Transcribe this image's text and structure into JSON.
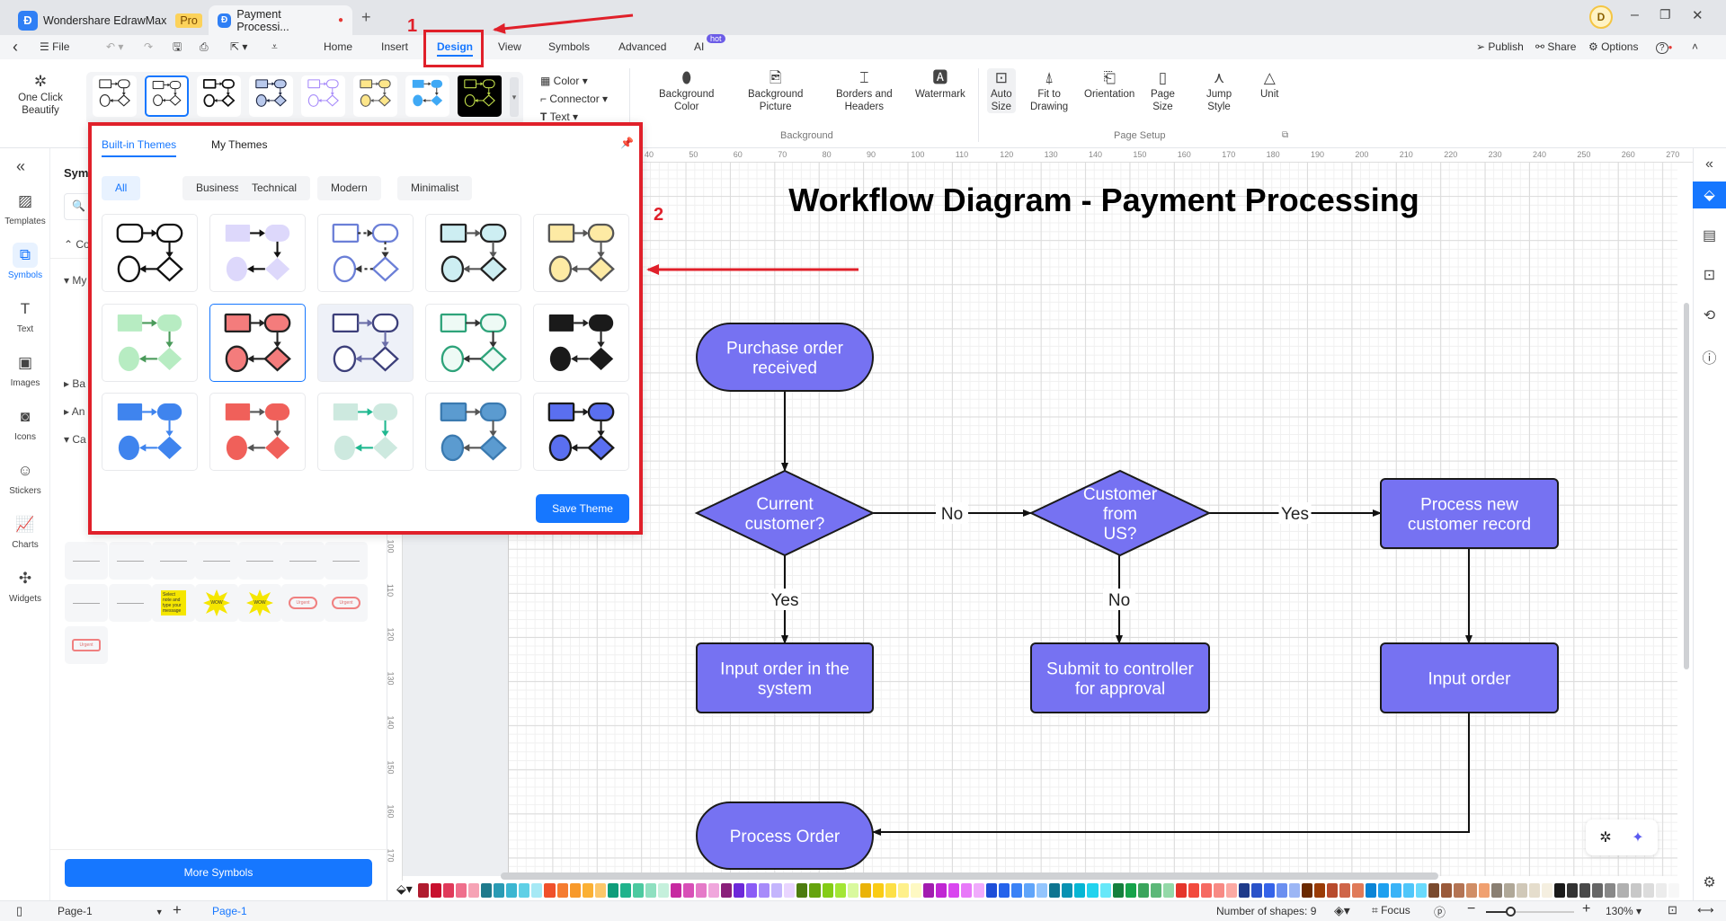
{
  "app": {
    "name": "Wondershare EdrawMax",
    "badge": "Pro",
    "doc_tab": "Payment Processi...",
    "new_tab": "+",
    "avatar": "D"
  },
  "menu": {
    "back": "‹",
    "file": "File",
    "items": [
      "Home",
      "Insert",
      "Design",
      "View",
      "Symbols",
      "Advanced",
      "AI"
    ],
    "active": "Design",
    "ai_badge": "hot",
    "publish": "Publish",
    "share": "Share",
    "options": "Options",
    "help": "?"
  },
  "ribbon": {
    "beautify": "One Click Beautify",
    "theme_thumbs": [
      {
        "fill": "#ffffff",
        "stroke": "#222222",
        "arrow": "#222222",
        "bg": "#ffffff"
      },
      {
        "fill": "#ffffff",
        "stroke": "#222222",
        "arrow": "#222222",
        "bg": "#ffffff",
        "selected": true
      },
      {
        "fill": "#ffffff",
        "stroke": "#111111",
        "arrow": "#111111",
        "bg": "#ffffff",
        "bold": true
      },
      {
        "fill": "#b9c9ec",
        "stroke": "#1c2541",
        "arrow": "#1c2541",
        "bg": "#ffffff"
      },
      {
        "fill": "#ffffff",
        "stroke": "#a78bfa",
        "arrow": "#a78bfa",
        "bg": "#ffffff"
      },
      {
        "fill": "#fde68a",
        "stroke": "#555555",
        "arrow": "#555555",
        "bg": "#ffffff"
      },
      {
        "fill": "#3fa9f5",
        "stroke": "none",
        "arrow": "#333333",
        "bg": "#ffffff"
      },
      {
        "fill": "#000000",
        "stroke": "#c3e04a",
        "arrow": "#c3e04a",
        "bg": "#000000"
      }
    ],
    "color": "Color",
    "connector": "Connector",
    "text": "Text",
    "background_group": "Background",
    "page_setup_group": "Page Setup",
    "buttons": [
      {
        "l1": "Background",
        "l2": "Color",
        "icon": "paint-bucket-icon"
      },
      {
        "l1": "Background",
        "l2": "Picture",
        "icon": "picture-icon"
      },
      {
        "l1": "Borders and",
        "l2": "Headers",
        "icon": "borders-icon"
      },
      {
        "l1": "Watermark",
        "l2": "",
        "icon": "watermark-icon"
      },
      {
        "l1": "Auto",
        "l2": "Size",
        "icon": "auto-size-icon"
      },
      {
        "l1": "Fit to",
        "l2": "Drawing",
        "icon": "fit-icon"
      },
      {
        "l1": "Orientation",
        "l2": "",
        "icon": "orientation-icon"
      },
      {
        "l1": "Page",
        "l2": "Size",
        "icon": "page-size-icon"
      },
      {
        "l1": "Jump",
        "l2": "Style",
        "icon": "jump-style-icon"
      },
      {
        "l1": "Unit",
        "l2": "",
        "icon": "unit-icon"
      }
    ]
  },
  "leftbar": [
    {
      "label": "Templates",
      "icon": "▨"
    },
    {
      "label": "Symbols",
      "icon": "⧉",
      "active": true
    },
    {
      "label": "Text",
      "icon": "T"
    },
    {
      "label": "Images",
      "icon": "▣"
    },
    {
      "label": "Icons",
      "icon": "◙"
    },
    {
      "label": "Stickers",
      "icon": "☺"
    },
    {
      "label": "Charts",
      "icon": "📈"
    },
    {
      "label": "Widgets",
      "icon": "✣"
    }
  ],
  "symbols": {
    "title": "Sym",
    "sections": [
      "Co",
      "My",
      "Ba",
      "An",
      "Ca"
    ],
    "more": "More Symbols",
    "tile_labels": [
      "Select note and type your message",
      "WOW",
      "WOW",
      "Urgent",
      "Urgent",
      "Urgent"
    ]
  },
  "themes": {
    "tabs": [
      "Built-in Themes",
      "My Themes"
    ],
    "active_tab": "Built-in Themes",
    "filters": [
      "All",
      "Business",
      "Technical",
      "Modern",
      "Minimalist"
    ],
    "active_filter": "All",
    "save": "Save Theme",
    "cards": [
      {
        "fill": "#ffffff",
        "stroke": "#111111",
        "arrow": "#111111",
        "rounded": true
      },
      {
        "fill": "#ddd8fb",
        "stroke": "none",
        "arrow": "#111111"
      },
      {
        "fill": "#ffffff",
        "stroke": "#6b7fd7",
        "arrow": "#333333",
        "dashed": true
      },
      {
        "fill": "#cdeef2",
        "stroke": "#222222",
        "arrow": "#555555"
      },
      {
        "fill": "#fdeaa4",
        "stroke": "#555555",
        "arrow": "#555555"
      },
      {
        "fill": "#b7ecc2",
        "stroke": "none",
        "arrow": "#4a9a5a"
      },
      {
        "fill": "#f47c7c",
        "stroke": "#222222",
        "arrow": "#222222",
        "selected": true
      },
      {
        "fill": "#ffffff",
        "stroke": "#3c3f7a",
        "arrow": "#6a6da8",
        "hover": true
      },
      {
        "fill": "#eefaf5",
        "stroke": "#2ea37a",
        "arrow": "#333333"
      },
      {
        "fill": "#1a1a1a",
        "stroke": "none",
        "arrow": "#222222"
      },
      {
        "fill": "#3f84ee",
        "stroke": "none",
        "arrow": "#3f84ee"
      },
      {
        "fill": "#f0605a",
        "stroke": "none",
        "arrow": "#555555"
      },
      {
        "fill": "#cde9df",
        "stroke": "none",
        "arrow": "#20b890"
      },
      {
        "fill": "#5b9bd0",
        "stroke": "#3b7ab0",
        "arrow": "#555555"
      },
      {
        "fill": "#5a6ff0",
        "stroke": "#1a1a1a",
        "arrow": "#1a1a1a"
      }
    ]
  },
  "annotations": {
    "step1": "1",
    "step2": "2",
    "color": "#e0202a"
  },
  "ruler": {
    "h": [
      40,
      50,
      60,
      70,
      80,
      90,
      100,
      110,
      120,
      130,
      140,
      150,
      160,
      170,
      180,
      190,
      200,
      210,
      220,
      230,
      240,
      250,
      260,
      270
    ],
    "v": [
      100,
      110,
      120,
      130,
      140,
      150,
      160,
      170
    ]
  },
  "diagram": {
    "title": "Workflow Diagram - Payment Processing",
    "fill": "#7672f2",
    "stroke": "#1a1a1a",
    "nodes": [
      {
        "id": "purchase",
        "shape": "terminator",
        "lines": [
          "Purchase order",
          "received"
        ]
      },
      {
        "id": "current",
        "shape": "decision",
        "lines": [
          "Current",
          "customer?"
        ]
      },
      {
        "id": "us",
        "shape": "decision",
        "lines": [
          "Customer",
          "from",
          "US?"
        ]
      },
      {
        "id": "newrec",
        "shape": "process",
        "lines": [
          "Process new",
          "customer record"
        ]
      },
      {
        "id": "inputsys",
        "shape": "process",
        "lines": [
          "Input order in the",
          "system"
        ]
      },
      {
        "id": "submit",
        "shape": "process",
        "lines": [
          "Submit to controller",
          "for approval"
        ]
      },
      {
        "id": "input",
        "shape": "process",
        "lines": [
          "Input order"
        ]
      },
      {
        "id": "processorder",
        "shape": "terminator",
        "lines": [
          "Process Order"
        ]
      }
    ],
    "edges": [
      {
        "from": "purchase",
        "to": "current",
        "label": ""
      },
      {
        "from": "current",
        "to": "us",
        "label": "No"
      },
      {
        "from": "us",
        "to": "newrec",
        "label": "Yes"
      },
      {
        "from": "current",
        "to": "inputsys",
        "label": "Yes"
      },
      {
        "from": "us",
        "to": "submit",
        "label": "No"
      },
      {
        "from": "newrec",
        "to": "input",
        "label": ""
      },
      {
        "from": "input",
        "to": "processorder",
        "label": ""
      }
    ]
  },
  "palette": [
    "#b01b2e",
    "#c8102e",
    "#e03a5a",
    "#ef6f8c",
    "#f6a3b5",
    "#1f7a8c",
    "#2a9bb4",
    "#3bb6d1",
    "#5fd0e6",
    "#a6e9f5",
    "#f0512b",
    "#f57c30",
    "#f8992a",
    "#fbb034",
    "#fcc76a",
    "#0f9d7a",
    "#20b38c",
    "#4ccaa0",
    "#8fe0c0",
    "#c5f0dc",
    "#c72aa0",
    "#d84fb7",
    "#e57ac8",
    "#f0a6dc",
    "#8a1f7a",
    "#6d28d9",
    "#8b5cf6",
    "#a78bfa",
    "#c4b5fd",
    "#e9d5ff",
    "#4d7c0f",
    "#65a30d",
    "#84cc16",
    "#a3e635",
    "#d9f99d",
    "#eab308",
    "#facc15",
    "#fde047",
    "#fef08a",
    "#fef9c3",
    "#a21caf",
    "#c026d3",
    "#d946ef",
    "#e879f9",
    "#f0abfc",
    "#1d4ed8",
    "#2563eb",
    "#3b82f6",
    "#60a5fa",
    "#93c5fd",
    "#0e7490",
    "#0891b2",
    "#06b6d4",
    "#22d3ee",
    "#67e8f9",
    "#15803d",
    "#16a34a",
    "#3aa55c",
    "#5cb878",
    "#94d9a8",
    "#e5352b",
    "#f24a3d",
    "#f66a62",
    "#f88a84",
    "#fba9a3",
    "#1e3a8a",
    "#2a52c8",
    "#3563e9",
    "#6b8ff0",
    "#9cb6f5",
    "#6b2a00",
    "#9a3b06",
    "#b84a2c",
    "#cf6548",
    "#e07a58",
    "#0a84d6",
    "#1ea0ef",
    "#3ab3f7",
    "#4fc6fa",
    "#69dafc",
    "#7a4a2e",
    "#9a5a3a",
    "#b47454",
    "#d08e66",
    "#f0a070",
    "#8a7f72",
    "#b0a898",
    "#d0c8b8",
    "#e5ddcc",
    "#f5efe0",
    "#1a1a1a",
    "#333333",
    "#4a4a4a",
    "#666666",
    "#888888",
    "#b0b0b0",
    "#c8c8c8",
    "#dcdcdc",
    "#ececec",
    "#f7f7f7",
    "#ffffff"
  ],
  "status": {
    "page_select": "Page-1",
    "add": "+",
    "page_tab": "Page-1",
    "shapes": "Number of shapes: 9",
    "focus": "Focus",
    "zoom": "130%",
    "zoom_level": 130
  }
}
